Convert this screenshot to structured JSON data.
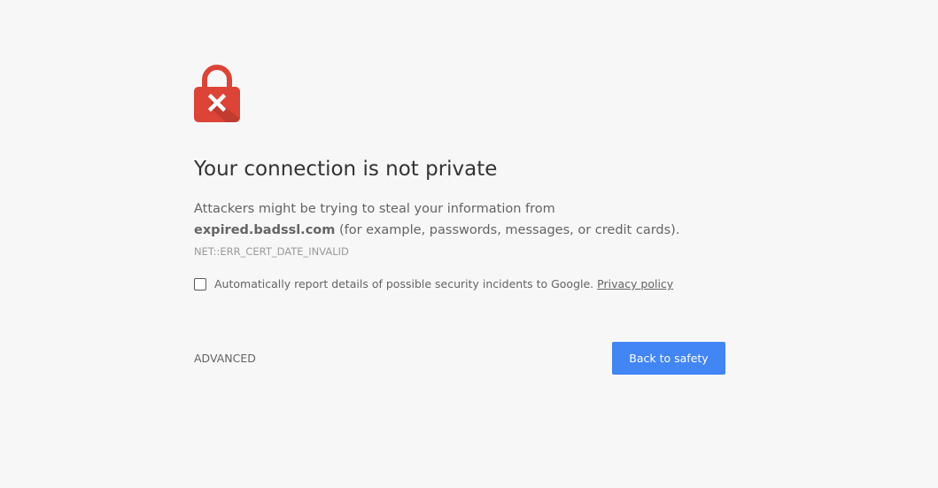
{
  "interstitial": {
    "heading": "Your connection is not private",
    "explanation_before": "Attackers might be trying to steal your information from ",
    "domain": "expired.badssl.com",
    "explanation_after": " (for example, passwords, messages, or credit cards). ",
    "error_code": "NET::ERR_CERT_DATE_INVALID",
    "report_label": "Automatically report details of possible security incidents to Google.",
    "privacy_link": "Privacy policy",
    "report_checked": false,
    "advanced_label": "ADVANCED",
    "primary_button": "Back to safety",
    "icon": "lock-error-icon"
  },
  "colors": {
    "background": "#f7f7f7",
    "lock_red": "#db4437",
    "primary_blue": "#4285f4",
    "heading_text": "#333333",
    "body_text": "#646464",
    "error_code_text": "#9a9a9a"
  }
}
